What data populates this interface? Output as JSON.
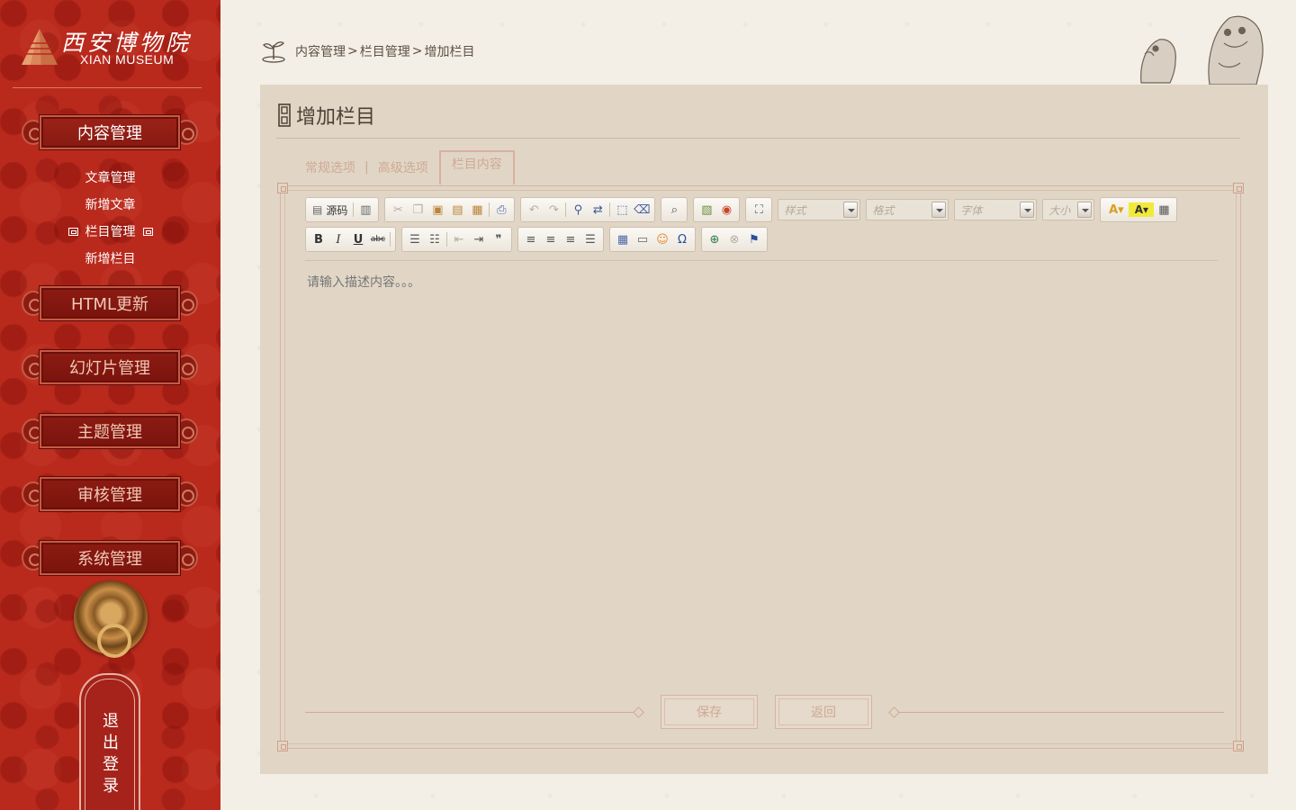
{
  "brand": {
    "name_cn": "西安博物院",
    "name_en": "XIAN MUSEUM"
  },
  "sidebar": {
    "menus": [
      {
        "label": "内容管理",
        "active": true
      },
      {
        "label": "HTML更新"
      },
      {
        "label": "幻灯片管理"
      },
      {
        "label": "主题管理"
      },
      {
        "label": "审核管理"
      },
      {
        "label": "系统管理"
      }
    ],
    "sub_items": [
      {
        "label": "文章管理"
      },
      {
        "label": "新增文章"
      },
      {
        "label": "栏目管理",
        "selected": true
      },
      {
        "label": "新增栏目"
      }
    ],
    "logout_label": "退出登录"
  },
  "breadcrumb": {
    "items": [
      "内容管理",
      "栏目管理",
      "增加栏目"
    ],
    "separator": ">"
  },
  "panel": {
    "title": "增加栏目",
    "tabs": [
      {
        "label": "常规选项"
      },
      {
        "label": "高级选项"
      },
      {
        "label": "栏目内容",
        "active": true
      }
    ],
    "tab_separator": "|",
    "editor": {
      "source_label": "源码",
      "combos": [
        "样式",
        "格式",
        "字体",
        "大小"
      ],
      "placeholder": "请输入描述内容。。。"
    },
    "buttons": {
      "save": "保存",
      "back": "返回"
    }
  },
  "colors": {
    "sidebar_red": "#b92a1d",
    "panel_bg": "#e1d6c5",
    "page_bg": "#f3efe6",
    "accent_muted": "#cfa895"
  }
}
